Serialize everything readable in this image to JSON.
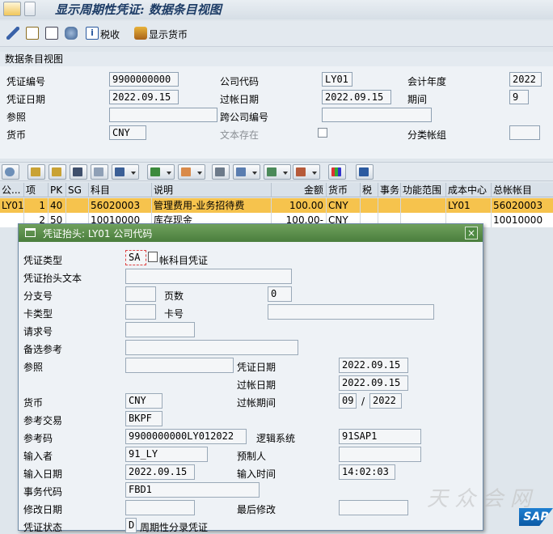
{
  "title": "显示周期性凭证: 数据条目视图",
  "toolbar": {
    "tax_label": "税收",
    "display_currency_label": "显示货币"
  },
  "section": {
    "title": "数据条目视图",
    "doc_number_label": "凭证编号",
    "doc_number": "9900000000",
    "company_code_label": "公司代码",
    "company_code": "LY01",
    "fiscal_year_label": "会计年度",
    "fiscal_year": "2022",
    "doc_date_label": "凭证日期",
    "doc_date": "2022.09.15",
    "posting_date_label": "过帐日期",
    "posting_date": "2022.09.15",
    "period_label": "期间",
    "period": "9",
    "reference_label": "参照",
    "reference": "",
    "cross_cc_label": "跨公司编号",
    "cross_cc": "",
    "currency_label": "货币",
    "currency": "CNY",
    "text_exists_label": "文本存在",
    "ledger_group_label": "分类帐组",
    "ledger_group": ""
  },
  "table": {
    "headers": [
      "公...",
      "项",
      "PK",
      "SG",
      "科目",
      "说明",
      "金额",
      "货币",
      "税",
      "事务",
      "功能范围",
      "成本中心",
      "总帐帐目"
    ],
    "rows": [
      [
        "LY01",
        "1",
        "40",
        "",
        "56020003",
        "管理费用-业务招待费",
        "100.00",
        "CNY",
        "",
        "",
        "",
        "LY01",
        "56020003"
      ],
      [
        "",
        "2",
        "50",
        "",
        "10010000",
        "库存现金",
        "100.00-",
        "CNY",
        "",
        "",
        "",
        "",
        "10010000"
      ]
    ]
  },
  "dialog": {
    "title": "凭证抬头: LY01 公司代码",
    "close_icon": "×",
    "doc_type_label": "凭证类型",
    "doc_type": "SA",
    "doc_type_desc": "帐科目凭证",
    "header_text_label": "凭证抬头文本",
    "header_text": "",
    "branch_label": "分支号",
    "branch": "",
    "pages_label": "页数",
    "pages": "0",
    "card_type_label": "卡类型",
    "card_type": "",
    "card_no_label": "卡号",
    "card_no": "",
    "request_no_label": "请求号",
    "request_no": "",
    "alt_ref_label": "备选参考",
    "alt_ref": "",
    "reference_label": "参照",
    "reference": "",
    "doc_date_label": "凭证日期",
    "doc_date": "2022.09.15",
    "posting_date_label": "过帐日期",
    "posting_date": "2022.09.15",
    "currency_label": "货币",
    "currency": "CNY",
    "posting_period_label": "过帐期间",
    "posting_period": "09",
    "posting_period_sep": "/",
    "posting_period_year": "2022",
    "ref_trans_label": "参考交易",
    "ref_trans": "BKPF",
    "ref_key_label": "参考码",
    "ref_key": "9900000000LY012022",
    "logical_system_label": "逻辑系统",
    "logical_system": "91SAP1",
    "entered_by_label": "输入者",
    "entered_by": "91_LY",
    "parked_by_label": "预制人",
    "parked_by": "",
    "entry_date_label": "输入日期",
    "entry_date": "2022.09.15",
    "entry_time_label": "输入时间",
    "entry_time": "14:02:03",
    "tcode_label": "事务代码",
    "tcode": "FBD1",
    "changed_on_label": "修改日期",
    "changed_on": "",
    "last_update_label": "最后修改",
    "last_update": "",
    "doc_status_label": "凭证状态",
    "doc_status": "D",
    "doc_status_desc": "周期性分录凭证"
  },
  "watermark": "天 众 会 网",
  "sap_logo": "SAP"
}
